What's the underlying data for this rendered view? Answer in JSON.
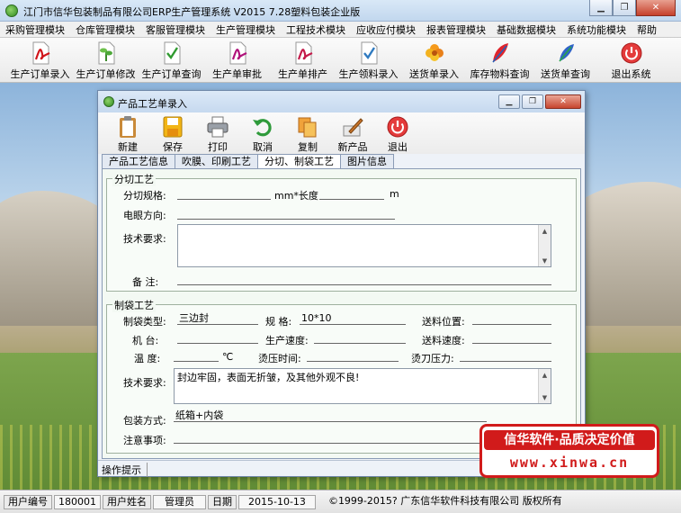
{
  "window": {
    "title": "江门市信华包装制品有限公司ERP生产管理系统  V2015  7.28塑料包装企业版"
  },
  "menu": [
    "采购管理模块",
    "仓库管理模块",
    "客服管理模块",
    "生产管理模块",
    "工程技术模块",
    "应收应付模块",
    "报表管理模块",
    "基础数据模块",
    "系统功能模块",
    "帮助"
  ],
  "toolbar": [
    {
      "label": "生产订单录入",
      "icon": "pdf-doc-icon"
    },
    {
      "label": "生产订单修改",
      "icon": "plant-doc-icon"
    },
    {
      "label": "生产订单查询",
      "icon": "doc-check-icon"
    },
    {
      "label": "生产单审批",
      "icon": "pdf-doc-icon"
    },
    {
      "label": "生产单排产",
      "icon": "pdf-doc-icon"
    },
    {
      "label": "生产领料录入",
      "icon": "doc-check-icon"
    },
    {
      "label": "送货单录入",
      "icon": "flower-icon"
    },
    {
      "label": "库存物料查询",
      "icon": "feather-icon"
    },
    {
      "label": "送货单查询",
      "icon": "quill-icon"
    },
    {
      "label": "退出系统",
      "icon": "exit-icon"
    }
  ],
  "child": {
    "title": "产品工艺单录入",
    "toolbar": [
      {
        "label": "新建",
        "icon": "clipboard-icon"
      },
      {
        "label": "保存",
        "icon": "floppy-icon"
      },
      {
        "label": "打印",
        "icon": "printer-icon"
      },
      {
        "label": "取消",
        "icon": "undo-icon"
      },
      {
        "label": "复制",
        "icon": "copy-icon"
      },
      {
        "label": "新产品",
        "icon": "pen-icon"
      },
      {
        "label": "退出",
        "icon": "exit-icon"
      }
    ],
    "tabs": [
      "产品工艺信息",
      "吹膜、印刷工艺",
      "分切、制袋工艺",
      "图片信息"
    ],
    "active_tab": 2,
    "cut_group": {
      "title": "分切工艺",
      "spec_label": "分切规格:",
      "spec_value": "",
      "mm_length_label": "mm*长度",
      "length_value": "",
      "m_label": "m",
      "corona_label": "电眼方向:",
      "corona_value": "",
      "tech_label": "技术要求:",
      "tech_value": "",
      "remark_label": "备    注:",
      "remark_value": ""
    },
    "bag_group": {
      "title": "制袋工艺",
      "type_label": "制袋类型:",
      "type_value": "三边封",
      "spec_label": "规  格:",
      "spec_value": "10*10",
      "feed_pos_label": "送料位置:",
      "feed_pos_value": "",
      "machine_label": "机  台:",
      "machine_value": "",
      "speed_label": "生产速度:",
      "speed_value": "",
      "feed_speed_label": "送料速度:",
      "feed_speed_value": "",
      "temp_label": "温  度:",
      "temp_value": "",
      "temp_unit": "℃",
      "press_time_label": "烫压时间:",
      "press_time_value": "",
      "knife_label": "烫刀压力:",
      "knife_value": "",
      "tech_label": "技术要求:",
      "tech_value": "封边牢固，表面无折皱，及其他外观不良!",
      "pack_label": "包装方式:",
      "pack_value": "纸箱+内袋",
      "notice_label": "注意事项:",
      "notice_value": ""
    },
    "status": "操作提示"
  },
  "banner": {
    "slogan": "信华软件·品质决定价值",
    "url": "www.xinwa.cn"
  },
  "statusbar": {
    "user_no_label": "用户编号",
    "user_no": "180001",
    "user_name_label": "用户姓名",
    "user_name": "管理员",
    "date_label": "日期",
    "date": "2015-10-13",
    "copyright": "©1999-2015?  广东信华软件科技有限公司   版权所有"
  }
}
